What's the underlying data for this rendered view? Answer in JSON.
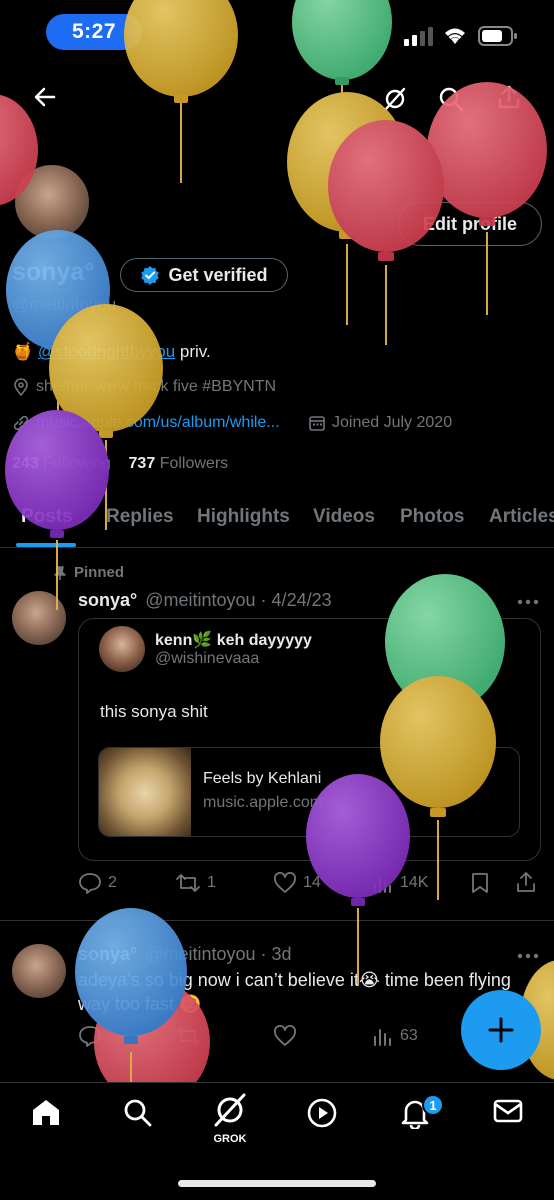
{
  "status_bar": {
    "time": "5:27"
  },
  "header": {
    "back_icon": "arrow-left-icon",
    "grok_icon": "grok-slash-icon",
    "search_icon": "search-icon",
    "share_icon": "share-icon"
  },
  "profile": {
    "display_name": "sonya°",
    "handle": "@meitintoyou",
    "edit_profile_label": "Edit profile",
    "get_verified_label": "Get verified",
    "bio_emoji": "🍯",
    "bio_link": "@stoodrightbyyou",
    "bio_suffix": " priv.",
    "pronouns_line": "she/her-www track five #BBYNTN",
    "website": "music.apple.com/us/album/while...",
    "joined": "Joined July 2020",
    "following_count": "243",
    "following_label": "Following",
    "followers_count": "737",
    "followers_label": "Followers"
  },
  "tabs": [
    "Posts",
    "Replies",
    "Highlights",
    "Videos",
    "Photos",
    "Articles"
  ],
  "posts": [
    {
      "pinned_label": "Pinned",
      "name": "sonya°",
      "handle_date": "@meitintoyou · 4/24/23",
      "quote": {
        "name": "kenn🌿 keh dayyyyy",
        "handle": "@wishinevaaa",
        "text": "this sonya shit",
        "link_title": "Feels by Kehlani",
        "link_domain": "music.apple.com"
      },
      "replies": "2",
      "reposts": "1",
      "likes": "14",
      "views": "14K"
    },
    {
      "name": "sonya°",
      "handle_date": "@meitintoyou · 3d",
      "text": "adeya’s so big now i can’t believe it😭 time been flying way too fast 🥹",
      "views": "63"
    }
  ],
  "bottom_nav": {
    "grok_label": "GROK",
    "notifications_badge": "1"
  },
  "colors": {
    "accent": "#1d9bf0",
    "background": "#000000",
    "muted": "#71767b",
    "time_pill": "#1d6cf2"
  }
}
